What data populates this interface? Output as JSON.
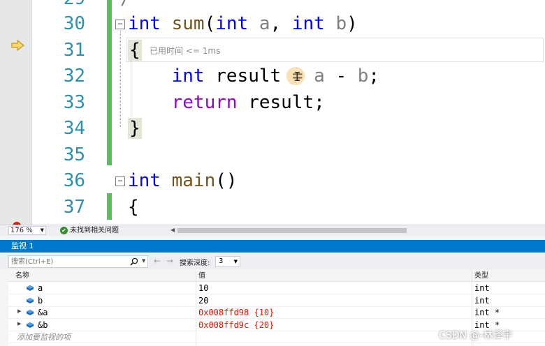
{
  "editor": {
    "partial_top": {
      "number": "29",
      "text": "/"
    },
    "lines": [
      {
        "number": "30",
        "tokens": [
          {
            "t": "int",
            "c": "kw"
          },
          {
            "t": " "
          },
          {
            "t": "sum",
            "c": "fn"
          },
          {
            "t": "("
          },
          {
            "t": "int",
            "c": "kw"
          },
          {
            "t": " "
          },
          {
            "t": "a",
            "c": "pm"
          },
          {
            "t": ", "
          },
          {
            "t": "int",
            "c": "kw"
          },
          {
            "t": " "
          },
          {
            "t": "b",
            "c": "pm"
          },
          {
            "t": ")"
          }
        ]
      },
      {
        "number": "31",
        "tokens": [
          {
            "t": "{",
            "c": "brace-hl"
          }
        ]
      },
      {
        "number": "32",
        "tokens": [
          {
            "t": "    "
          },
          {
            "t": "int",
            "c": "kw"
          },
          {
            "t": " result = "
          },
          {
            "t": "a",
            "c": "pm"
          },
          {
            "t": " - "
          },
          {
            "t": "b",
            "c": "pm"
          },
          {
            "t": ";"
          }
        ]
      },
      {
        "number": "33",
        "tokens": [
          {
            "t": "    "
          },
          {
            "t": "return",
            "c": "kw2"
          },
          {
            "t": " result;"
          }
        ]
      },
      {
        "number": "34",
        "tokens": [
          {
            "t": "}",
            "c": "brace-hl"
          }
        ]
      },
      {
        "number": "35",
        "tokens": []
      },
      {
        "number": "36",
        "tokens": [
          {
            "t": "int",
            "c": "kw"
          },
          {
            "t": " "
          },
          {
            "t": "main",
            "c": "fn"
          },
          {
            "t": "()"
          }
        ]
      },
      {
        "number": "37",
        "tokens": [
          {
            "t": "{"
          }
        ]
      }
    ],
    "collapse_glyph": "⊟",
    "perf_tip": "已用时间 <= 1ms",
    "execution_pointer_icon": "arrow-right-icon",
    "colors": {
      "keyword": "#0000ff",
      "function": "#74531f",
      "param": "#808080",
      "control": "#8f08c4",
      "line_number": "#2b91af",
      "change_bar": "#57c05a"
    }
  },
  "status": {
    "zoom": "176 %",
    "issues_text": "未找到相关问题"
  },
  "watch": {
    "title": "监视 1",
    "search_placeholder": "搜索(Ctrl+E)",
    "depth_label": "搜索深度:",
    "depth_value": "3",
    "columns": {
      "name": "名称",
      "value": "值",
      "type": "类型"
    },
    "rows": [
      {
        "name": "a",
        "value": "10",
        "type": "int",
        "expandable": false,
        "changed": false
      },
      {
        "name": "b",
        "value": "20",
        "type": "int",
        "expandable": false,
        "changed": false
      },
      {
        "name": "&a",
        "value": "0x008ffd98 {10}",
        "type": "int *",
        "expandable": true,
        "changed": true
      },
      {
        "name": "&b",
        "value": "0x008ffd9c {20}",
        "type": "int *",
        "expandable": true,
        "changed": true
      }
    ],
    "add_item_placeholder": "添加要监视的项",
    "colors": {
      "title_bg": "#007acc",
      "changed_value": "#e51400"
    }
  },
  "watermark": "CSDN @-林泽宇"
}
